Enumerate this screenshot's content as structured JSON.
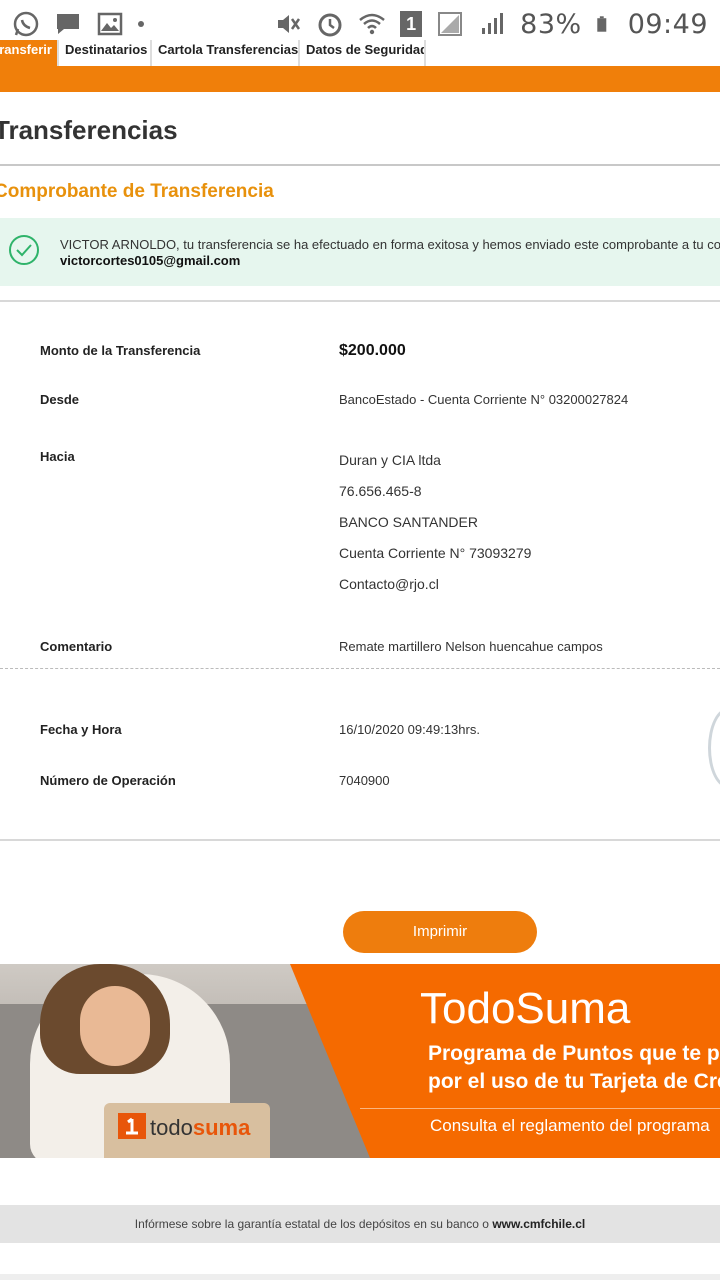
{
  "statusbar": {
    "battery": "83%",
    "time": "09:49",
    "sim_slot": "1"
  },
  "tabs": [
    {
      "label": "Transferir"
    },
    {
      "label": "Destinatarios"
    },
    {
      "label": "Cartola Transferencias"
    },
    {
      "label": "Datos de Seguridad"
    }
  ],
  "page": {
    "title": "Transferencias",
    "section_title": "Comprobante de Transferencia"
  },
  "success": {
    "message": "VICTOR ARNOLDO, tu transferencia se ha efectuado en forma exitosa y hemos enviado este comprobante a tu correo",
    "email": "victorcortes0105@gmail.com"
  },
  "details": {
    "monto_label": "Monto de la Transferencia",
    "monto_value": "$200.000",
    "desde_label": "Desde",
    "desde_value": "BancoEstado - Cuenta Corriente N° 03200027824",
    "hacia_label": "Hacia",
    "hacia_lines": [
      "Duran y CIA ltda",
      "76.656.465-8",
      "BANCO SANTANDER",
      "Cuenta Corriente N° 73093279",
      "Contacto@rjo.cl"
    ],
    "comentario_label": "Comentario",
    "comentario_value": "Remate martillero Nelson huencahue campos",
    "fecha_label": "Fecha y Hora",
    "fecha_value": "16/10/2020 09:49:13hrs.",
    "operacion_label": "Número de Operación",
    "operacion_value": "7040900"
  },
  "print_button": "Imprimir",
  "banner": {
    "title": "TodoSuma",
    "line1": "Programa de Puntos que te premia",
    "line2": "por el uso de tu Tarjeta de Crédito",
    "line3": "Consulta el reglamento del programa",
    "logo_part1": "todo",
    "logo_part2": "suma"
  },
  "footer": {
    "text": "Infórmese sobre la garantía estatal de los depósitos en su banco o ",
    "link": "www.cmfchile.cl"
  },
  "colors": {
    "brand_orange": "#f07f0a",
    "section_orange": "#e8910c",
    "success_bg": "#e6f6ee",
    "success_green": "#2fb36a"
  },
  "icons": [
    "whatsapp-icon",
    "chat-icon",
    "image-icon",
    "mute-icon",
    "alarm-icon",
    "wifi-icon",
    "sim-icon",
    "signal-icon",
    "battery-icon",
    "check-circle-icon"
  ]
}
